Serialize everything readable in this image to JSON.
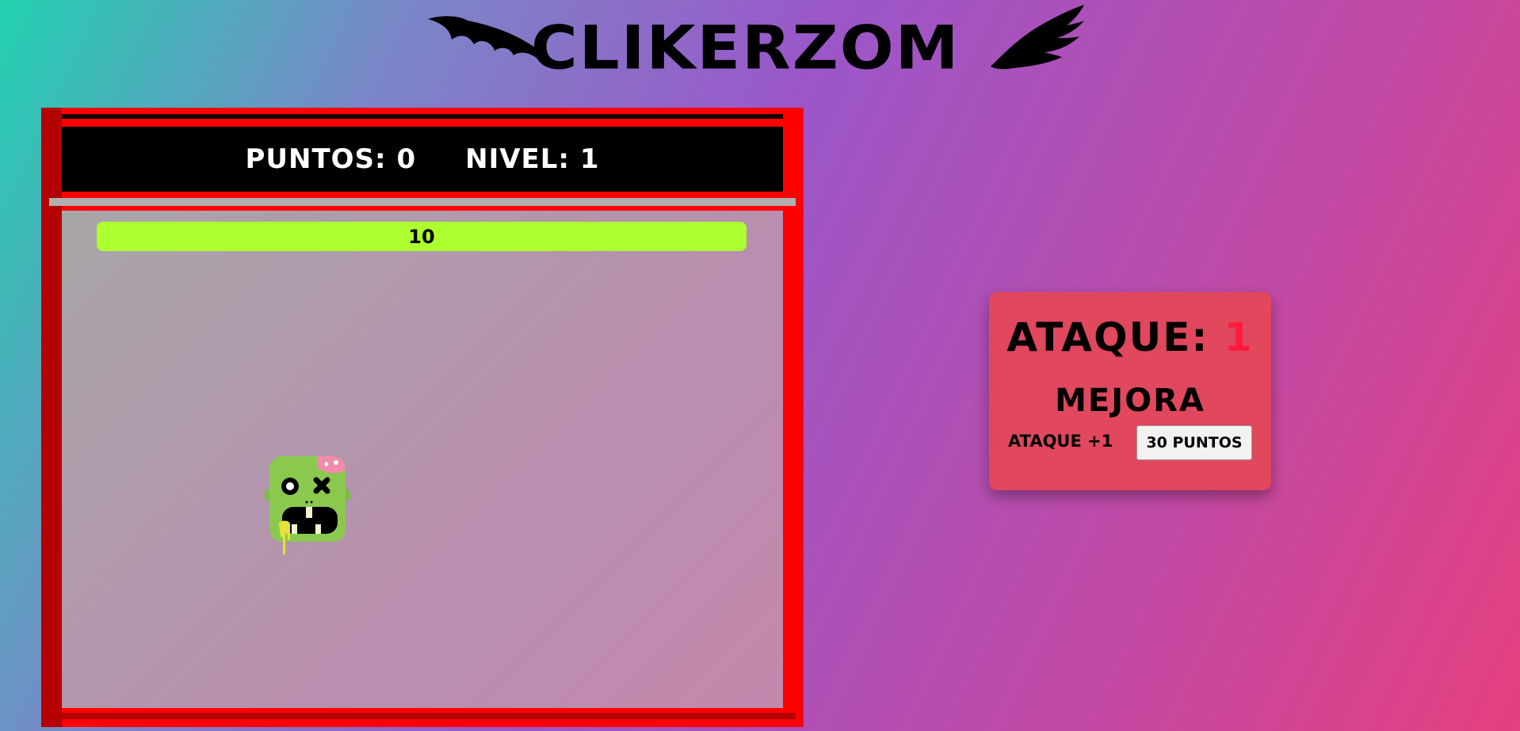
{
  "header": {
    "logo_text": "CLIKERZOM"
  },
  "hud": {
    "points_text": "PUNTOS: 0",
    "level_text": "NIVEL: 1"
  },
  "enemy": {
    "hp_text": "10",
    "hp_fraction": 1.0,
    "icon": "zombie-head-icon"
  },
  "upgrades": {
    "attack_label": "ATAQUE: ",
    "attack_value": "1",
    "title": "MEJORA",
    "item_label": "ATAQUE +1",
    "item_cost": "30 PUNTOS"
  },
  "colors": {
    "frame": "#ff0000",
    "hp_bar": "#adff2f",
    "panel": "#e1475d",
    "attack_value": "#ff1a3d"
  }
}
